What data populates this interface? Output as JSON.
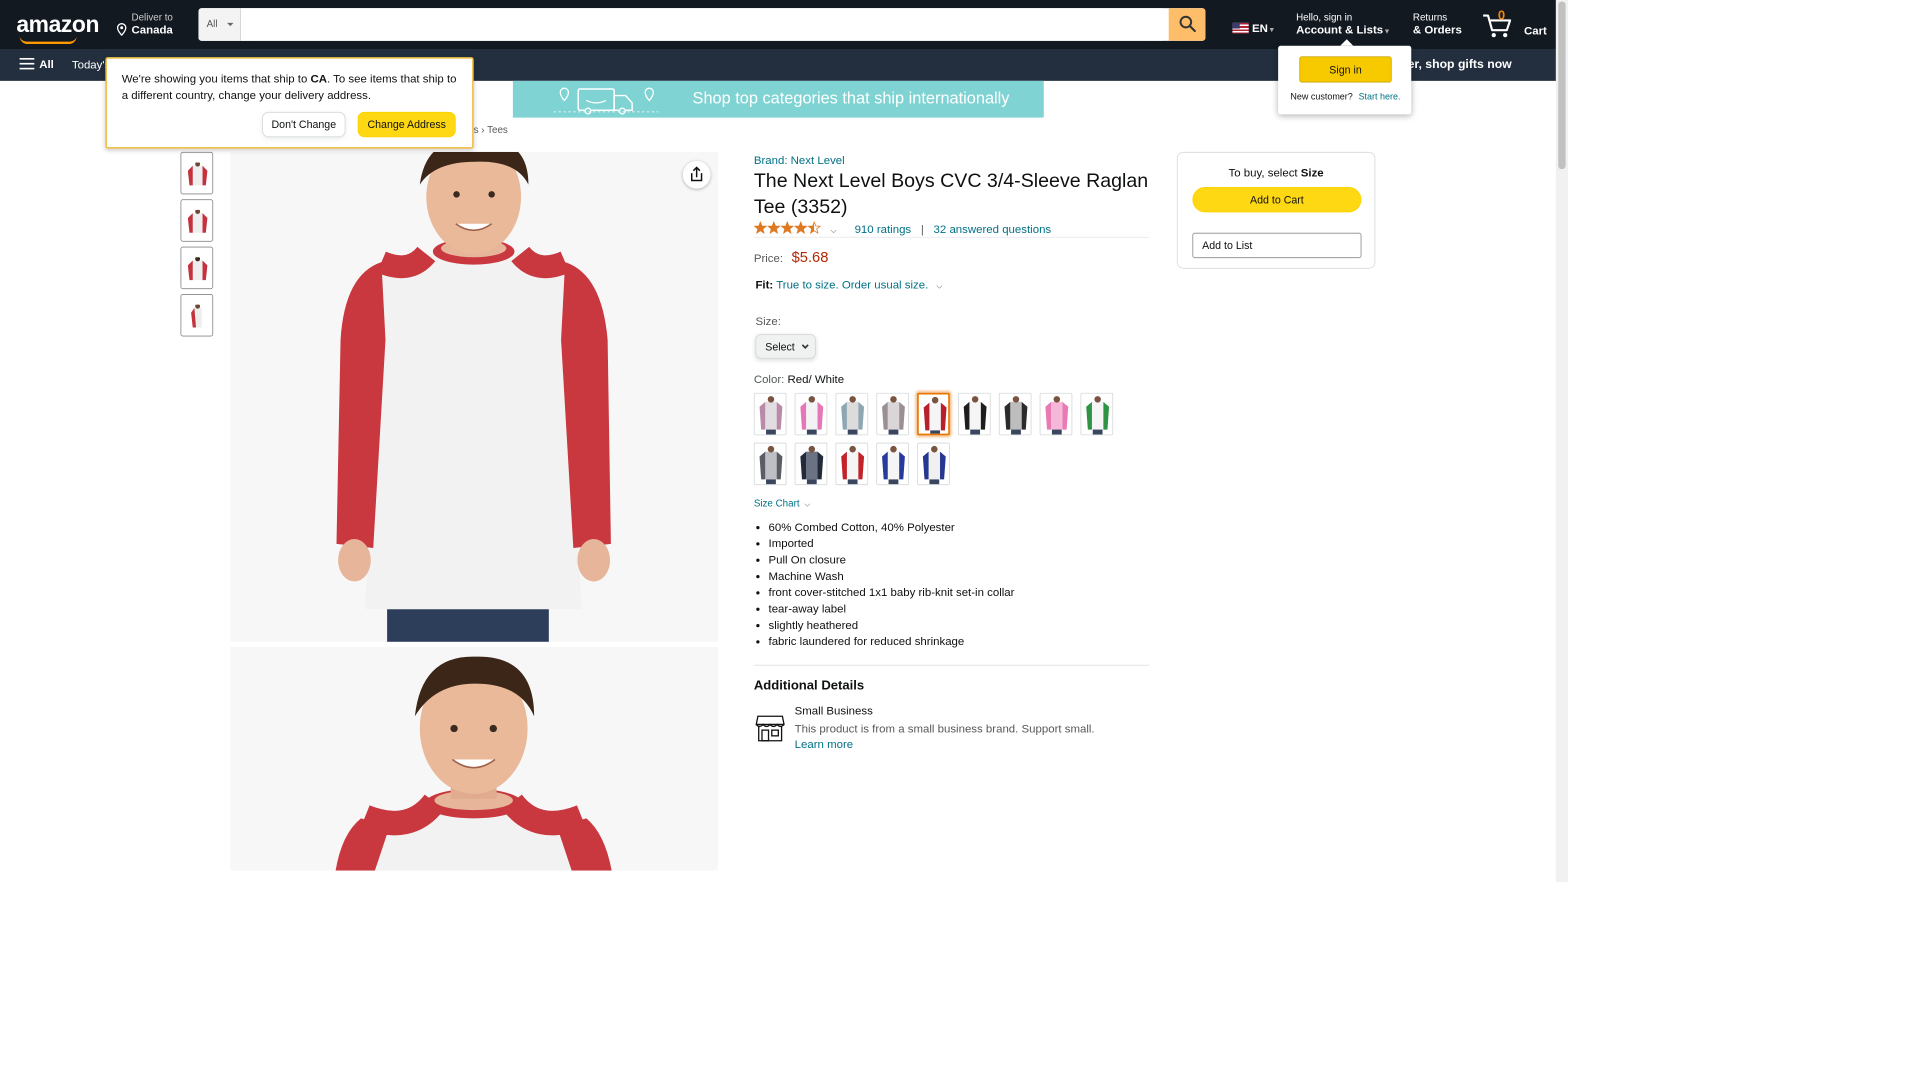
{
  "header": {
    "logo": "amazon",
    "deliver_line1": "Deliver to",
    "deliver_line2": "Canada",
    "search_category": "All",
    "search_placeholder": "",
    "language": "EN",
    "account_line1": "Hello, sign in",
    "account_line2": "Account & Lists",
    "returns_line1": "Returns",
    "returns_line2": "& Orders",
    "cart_count": "0",
    "cart_label": "Cart"
  },
  "navbelt": {
    "all_label": "All",
    "today": "Today's",
    "promo": "e cheer, shop gifts now"
  },
  "banner": {
    "text": "Shop top categories that ship internationally"
  },
  "breadcrumb": {
    "tail": "s  ›  Tees"
  },
  "ship_popover": {
    "text_before": "We're showing you items that ship to ",
    "country": "CA",
    "text_after": ". To see items that ship to a different country, change your delivery address.",
    "dont_change": "Don't Change",
    "change_address": "Change Address"
  },
  "signin_flyout": {
    "button": "Sign in",
    "new_customer": "New customer?",
    "start_here": "Start here."
  },
  "product": {
    "brand": "Brand: Next Level",
    "title": "The Next Level Boys CVC 3/4-Sleeve Raglan Tee (3352)",
    "rating_value": 4.5,
    "ratings_count": "910 ratings",
    "answered": "32 answered questions",
    "price_label": "Price:",
    "price": "$5.68",
    "fit_label": "Fit:",
    "fit_value": "True to size. Order usual size.",
    "size_label": "Size:",
    "size_value": "Select",
    "color_label": "Color:",
    "color_value": "Red/ White",
    "size_chart": "Size Chart",
    "bullets": [
      "60% Combed Cotton, 40% Polyester",
      "Imported",
      "Pull On closure",
      "Machine Wash",
      "front cover-stitched 1x1 baby rib-knit set-in collar",
      "tear-away label",
      "slightly heathered",
      "fabric laundered for reduced shrinkage"
    ],
    "additional_details": "Additional Details",
    "small_business_title": "Small Business",
    "small_business_desc": "This product is from a small business brand. Support small.",
    "learn_more": "Learn more"
  },
  "swatches": [
    {
      "sleeve": "#b98ba8",
      "body": "#e2dde0"
    },
    {
      "sleeve": "#e577b8",
      "body": "#f3f3f3"
    },
    {
      "sleeve": "#8ea7b3",
      "body": "#dcdcdc"
    },
    {
      "sleeve": "#9a8f95",
      "body": "#dad6d8"
    },
    {
      "sleeve": "#b9202e",
      "body": "#f5f5f5"
    },
    {
      "sleeve": "#1e1e1e",
      "body": "#f5f5f5"
    },
    {
      "sleeve": "#2b2b2b",
      "body": "#bdbdbd"
    },
    {
      "sleeve": "#e87bb4",
      "body": "#f5b8d8"
    },
    {
      "sleeve": "#2e9444",
      "body": "#f5f5f5"
    },
    {
      "sleeve": "#5a5d66",
      "body": "#bdbfc4"
    },
    {
      "sleeve": "#232a3a",
      "body": "#6b7283"
    },
    {
      "sleeve": "#c2232b",
      "body": "#f5f5f5"
    },
    {
      "sleeve": "#283a9c",
      "body": "#f5f5f5"
    },
    {
      "sleeve": "#27368e",
      "body": "#f0f0f0"
    }
  ],
  "buybox": {
    "title_prefix": "To buy, select ",
    "title_bold": "Size",
    "add_to_cart": "Add to Cart",
    "add_to_list": "Add to List"
  },
  "colors": {
    "nav_dark": "#131921",
    "nav_belt": "#232f3e",
    "accent_orange": "#ff9900",
    "link": "#007185",
    "price_red": "#b12704",
    "button_yellow": "#ffd814"
  }
}
